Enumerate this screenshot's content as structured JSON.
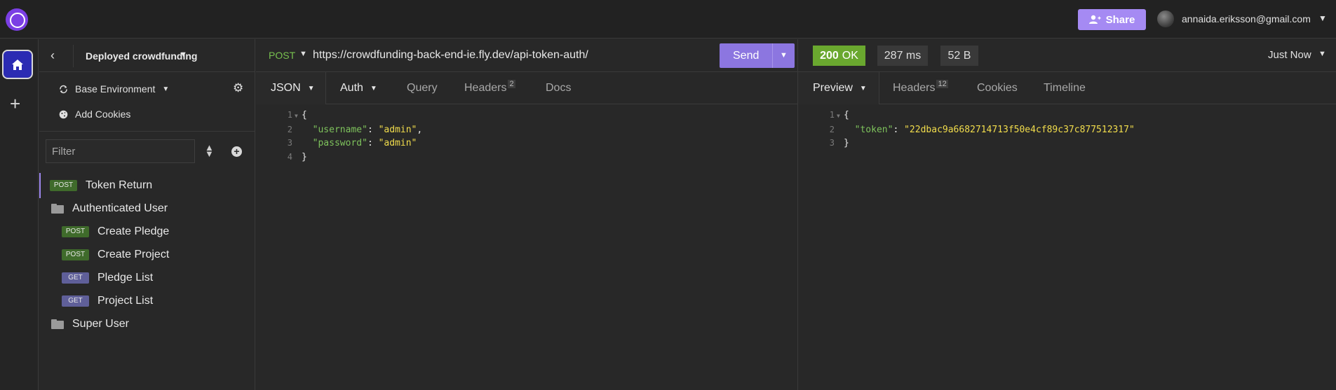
{
  "topbar": {
    "share_label": "Share",
    "user_email": "annaida.eriksson@gmail.com"
  },
  "sidebar": {
    "project_name": "Deployed crowdfunding",
    "environment_label": "Base Environment",
    "cookies_label": "Add Cookies",
    "filter_placeholder": "Filter",
    "items": [
      {
        "kind": "request",
        "method": "POST",
        "label": "Token Return",
        "active": true
      },
      {
        "kind": "folder",
        "label": "Authenticated User"
      },
      {
        "kind": "request",
        "method": "POST",
        "label": "Create Pledge"
      },
      {
        "kind": "request",
        "method": "POST",
        "label": "Create Project"
      },
      {
        "kind": "request",
        "method": "GET",
        "label": "Pledge List"
      },
      {
        "kind": "request",
        "method": "GET",
        "label": "Project List"
      },
      {
        "kind": "folder",
        "label": "Super User"
      }
    ]
  },
  "request": {
    "method": "POST",
    "url": "https://crowdfunding-back-end-ie.fly.dev/api-token-auth/",
    "send_label": "Send",
    "tabs": [
      {
        "label": "JSON"
      },
      {
        "label": "Auth"
      },
      {
        "label": "Query"
      },
      {
        "label": "Headers",
        "count": "2"
      },
      {
        "label": "Docs"
      }
    ],
    "body": {
      "line_numbers": [
        "1",
        "2",
        "3",
        "4"
      ],
      "open": "{",
      "close": "}",
      "fields": [
        {
          "key": "\"username\"",
          "value": "\"admin\"",
          "trail": ","
        },
        {
          "key": "\"password\"",
          "value": "\"admin\"",
          "trail": ""
        }
      ]
    }
  },
  "response": {
    "status_code": "200",
    "status_text": "OK",
    "time": "287 ms",
    "size": "52 B",
    "received": "Just Now",
    "tabs": [
      {
        "label": "Preview"
      },
      {
        "label": "Headers",
        "count": "12"
      },
      {
        "label": "Cookies"
      },
      {
        "label": "Timeline"
      }
    ],
    "body": {
      "line_numbers": [
        "1",
        "2",
        "3"
      ],
      "open": "{",
      "close": "}",
      "fields": [
        {
          "key": "\"token\"",
          "value": "\"22dbac9a6682714713f50e4cf89c37c877512317\""
        }
      ]
    }
  },
  "colors": {
    "accent": "#8c76e0",
    "post_badge": "#3f6b2b",
    "get_badge": "#5f5f99",
    "status_ok": "#6aa82f"
  }
}
